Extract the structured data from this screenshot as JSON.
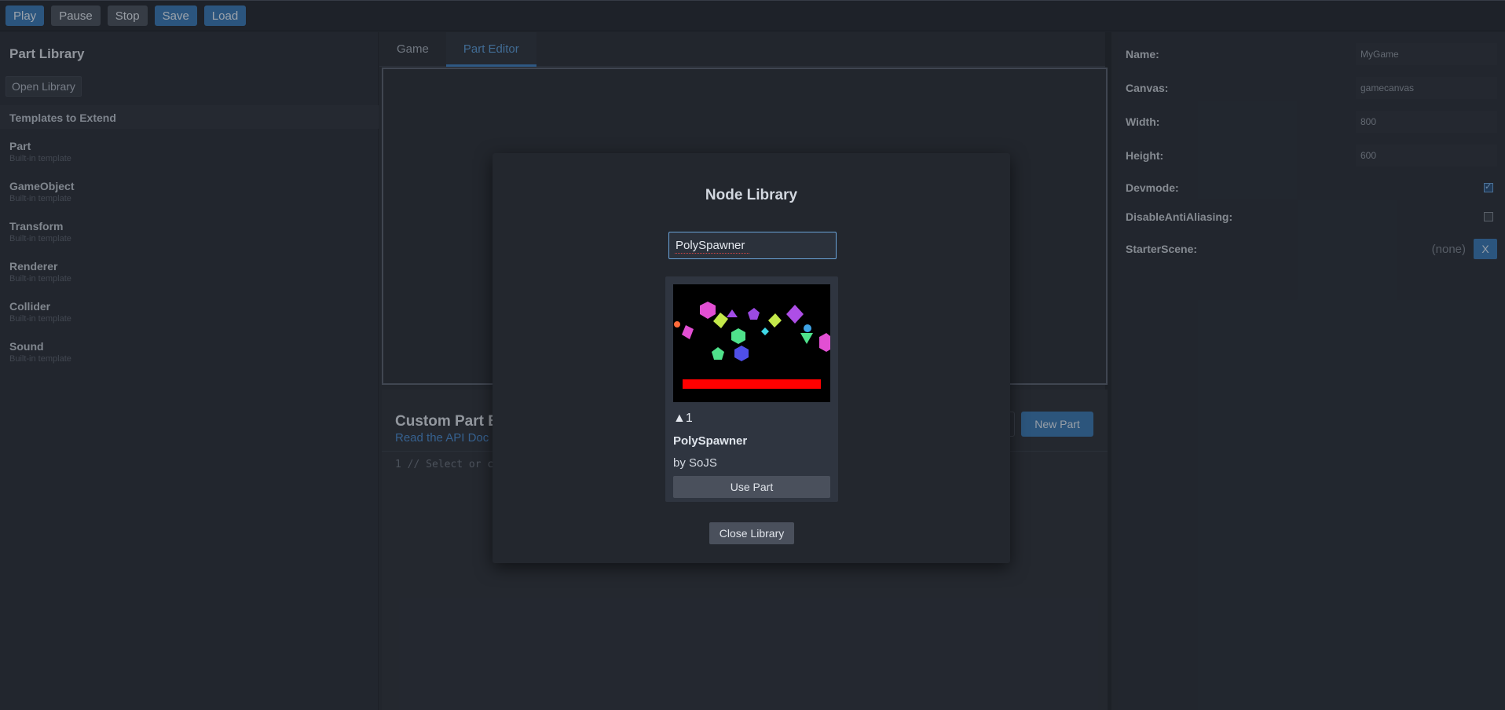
{
  "toolbar": {
    "play": "Play",
    "pause": "Pause",
    "stop": "Stop",
    "save": "Save",
    "load": "Load"
  },
  "left_panel": {
    "title": "Part Library",
    "open_library": "Open Library",
    "templates_header": "Templates to Extend",
    "templates": [
      {
        "name": "Part",
        "sub": "Built-in template"
      },
      {
        "name": "GameObject",
        "sub": "Built-in template"
      },
      {
        "name": "Transform",
        "sub": "Built-in template"
      },
      {
        "name": "Renderer",
        "sub": "Built-in template"
      },
      {
        "name": "Collider",
        "sub": "Built-in template"
      },
      {
        "name": "Sound",
        "sub": "Built-in template"
      }
    ]
  },
  "center": {
    "tabs": [
      {
        "label": "Game",
        "active": false
      },
      {
        "label": "Part Editor",
        "active": true
      }
    ],
    "custom_part_title": "Custom Part E",
    "api_link": "Read the API Doc",
    "new_part": "New Part",
    "code_line": "1 // Select or c"
  },
  "properties": {
    "name_label": "Name:",
    "name_value": "MyGame",
    "canvas_label": "Canvas:",
    "canvas_value": "gamecanvas",
    "width_label": "Width:",
    "width_value": "800",
    "height_label": "Height:",
    "height_value": "600",
    "devmode_label": "Devmode:",
    "devmode_checked": true,
    "disable_aa_label": "DisableAntiAliasing:",
    "disable_aa_checked": false,
    "starter_scene_label": "StarterScene:",
    "starter_scene_value": "(none)",
    "starter_scene_clear": "X"
  },
  "modal": {
    "title": "Node Library",
    "search_value": "PolySpawner",
    "result": {
      "votes": "▲1",
      "name": "PolySpawner",
      "author": "by SoJS",
      "use_button": "Use Part"
    },
    "close_button": "Close Library"
  },
  "colors": {
    "accent": "#3a78b5",
    "background": "#2b303a",
    "modal_bg": "#23272e"
  }
}
